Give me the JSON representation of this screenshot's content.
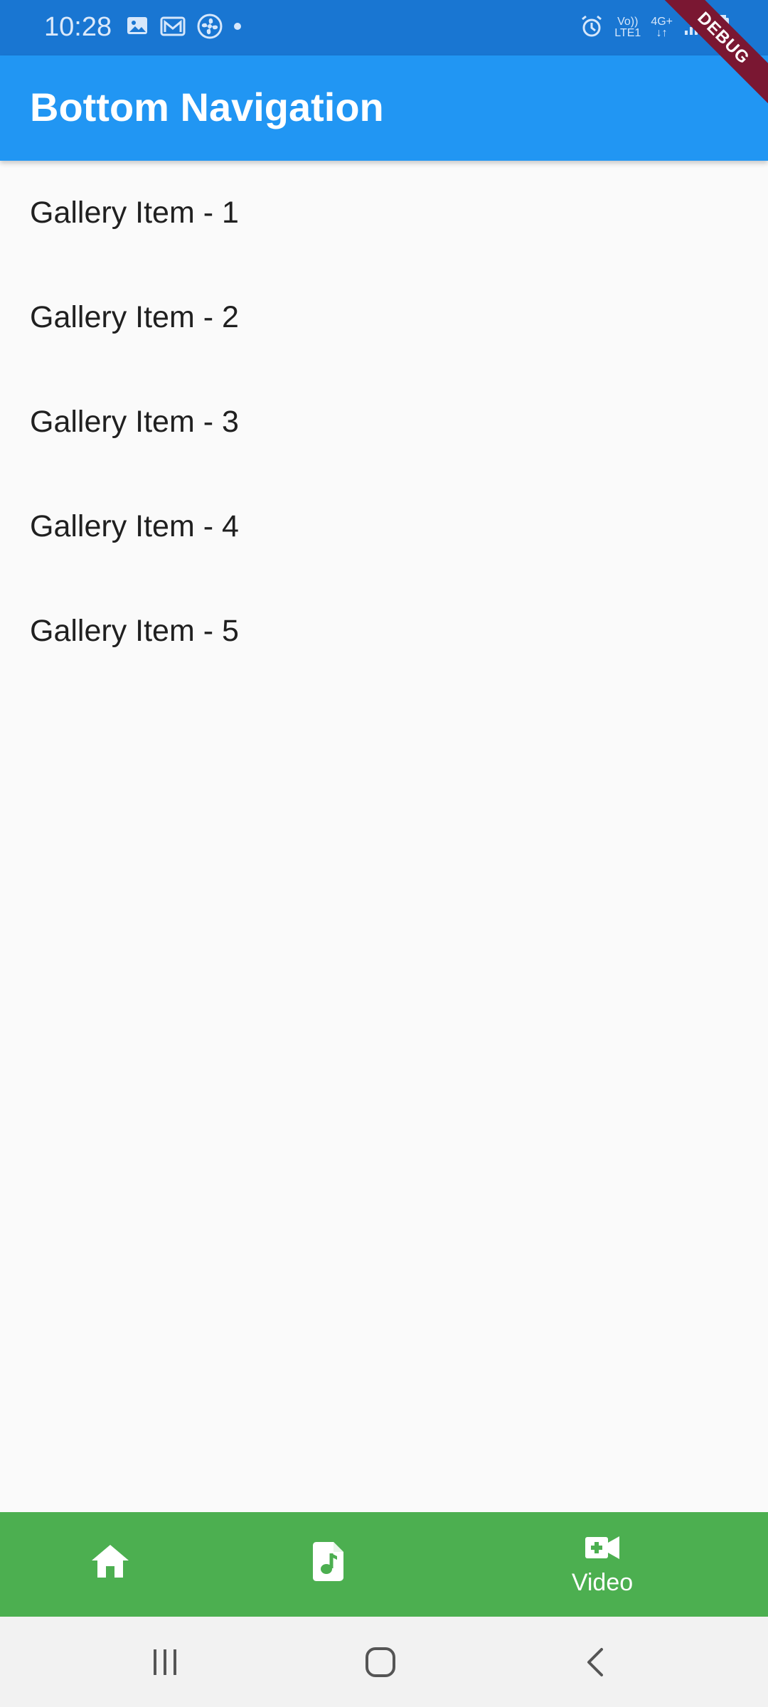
{
  "status_bar": {
    "time": "10:28",
    "left_icons": [
      "image-icon",
      "mail-icon",
      "fan-icon",
      "dot-icon"
    ],
    "right_icons": [
      "alarm-icon",
      "volte-icon",
      "network-4g-icon",
      "signal-icon",
      "battery-icon"
    ],
    "volte_top": "Vo))",
    "volte_bottom": "LTE1",
    "network_label": "4G+",
    "debug_label": "DEBUG"
  },
  "app_bar": {
    "title": "Bottom Navigation"
  },
  "gallery": {
    "items": [
      "Gallery Item - 1",
      "Gallery Item - 2",
      "Gallery Item - 3",
      "Gallery Item - 4",
      "Gallery Item - 5"
    ]
  },
  "bottom_nav": {
    "items": [
      {
        "icon": "home-icon",
        "label": ""
      },
      {
        "icon": "music-file-icon",
        "label": ""
      },
      {
        "icon": "video-call-icon",
        "label": "Video"
      }
    ]
  },
  "colors": {
    "status_bar": "#1976d2",
    "app_bar": "#2196f3",
    "bottom_nav": "#4caf50",
    "debug_ribbon": "#7a1732",
    "background": "#fafafa",
    "system_nav": "#f2f2f2"
  }
}
